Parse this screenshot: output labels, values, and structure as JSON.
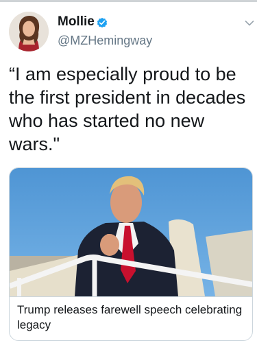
{
  "tweet": {
    "author": {
      "display_name": "Mollie",
      "handle": "@MZHemingway",
      "verified": true,
      "avatar_icon": "profile-photo"
    },
    "text": "“I am especially proud to be\nthe first president in decades\nwho has started no new\nwars.\"",
    "menu_icon": "chevron-down-icon"
  },
  "link_card": {
    "image_icon": "news-photo",
    "title": "Trump releases farewell speech celebrating legacy"
  },
  "colors": {
    "verified_badge": "#1da1f2",
    "handle_gray": "#657786",
    "border": "#ccd6dd",
    "sky": "#5f9fd6",
    "tie": "#c8102e"
  }
}
